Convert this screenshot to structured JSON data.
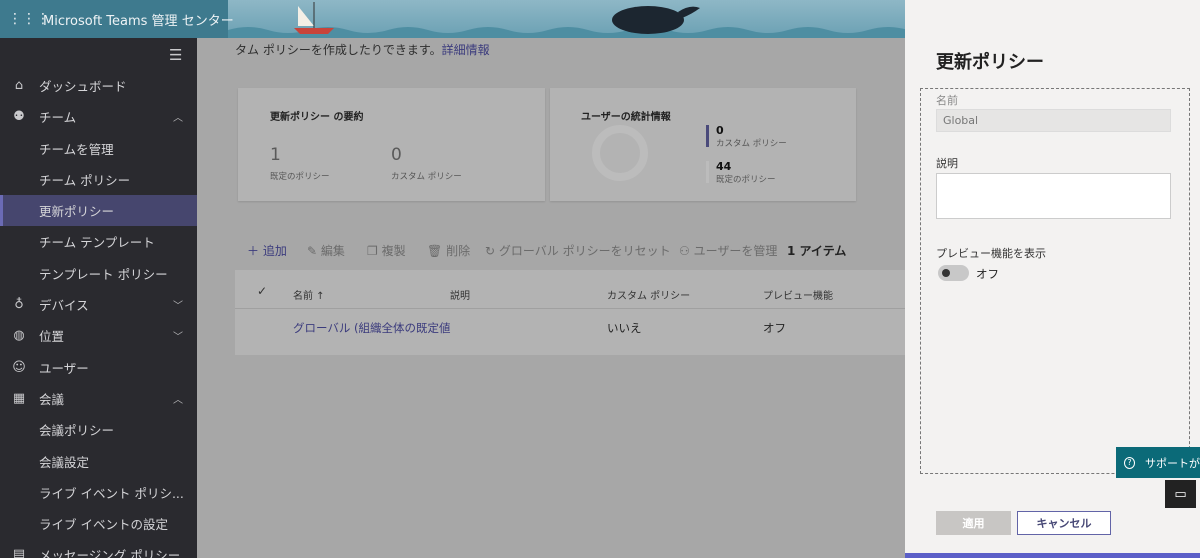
{
  "header": {
    "app_title": "Microsoft Teams 管理 センター"
  },
  "sidebar": {
    "items": [
      {
        "label": "ダッシュボード"
      },
      {
        "label": "チーム"
      },
      {
        "label": "チームを管理"
      },
      {
        "label": "チーム ポリシー"
      },
      {
        "label": "更新ポリシー"
      },
      {
        "label": "チーム テンプレート"
      },
      {
        "label": "テンプレート ポリシー"
      },
      {
        "label": "デバイス"
      },
      {
        "label": "位置"
      },
      {
        "label": "ユーザー"
      },
      {
        "label": "会議"
      },
      {
        "label": "会議ポリシー"
      },
      {
        "label": "会議設定"
      },
      {
        "label": "ライブ イベント ポリシ..."
      },
      {
        "label": "ライブ イベントの設定"
      },
      {
        "label": "メッセージング ポリシー"
      }
    ]
  },
  "main": {
    "intro_text": "タム ポリシーを作成したりできます。",
    "intro_link": "詳細情報",
    "summary_card": {
      "title": "更新ポリシー の要約",
      "default_count": "1",
      "default_label": "既定のポリシー",
      "custom_count": "0",
      "custom_label": "カスタム ポリシー"
    },
    "stats_card": {
      "title": "ユーザーの統計情報",
      "custom_count": "0",
      "custom_label": "カスタム ポリシー",
      "default_count": "44",
      "default_label": "既定のポリシー",
      "colors": {
        "custom": "#4a4a7a",
        "default": "#bcbcbc"
      }
    },
    "toolbar": {
      "add": "追加",
      "edit": "編集",
      "copy": "複製",
      "delete": "削除",
      "reset": "グローバル ポリシーをリセット",
      "manage_users": "ユーザーを管理",
      "item_count": "1 アイテム"
    },
    "table": {
      "columns": [
        "名前 ↑",
        "説明",
        "カスタム ポリシー",
        "プレビュー機能"
      ],
      "rows": [
        {
          "name": "グローバル (組織全体の既定値",
          "description": "",
          "custom": "いいえ",
          "preview": "オフ"
        }
      ]
    }
  },
  "panel": {
    "title": "更新ポリシー",
    "name_label": "名前",
    "name_value": "Global",
    "description_label": "説明",
    "description_value": "",
    "preview_label": "プレビュー機能を表示",
    "toggle_state": "オフ",
    "apply": "適用",
    "cancel": "キャンセル"
  },
  "floating": {
    "help": "サポートが"
  }
}
